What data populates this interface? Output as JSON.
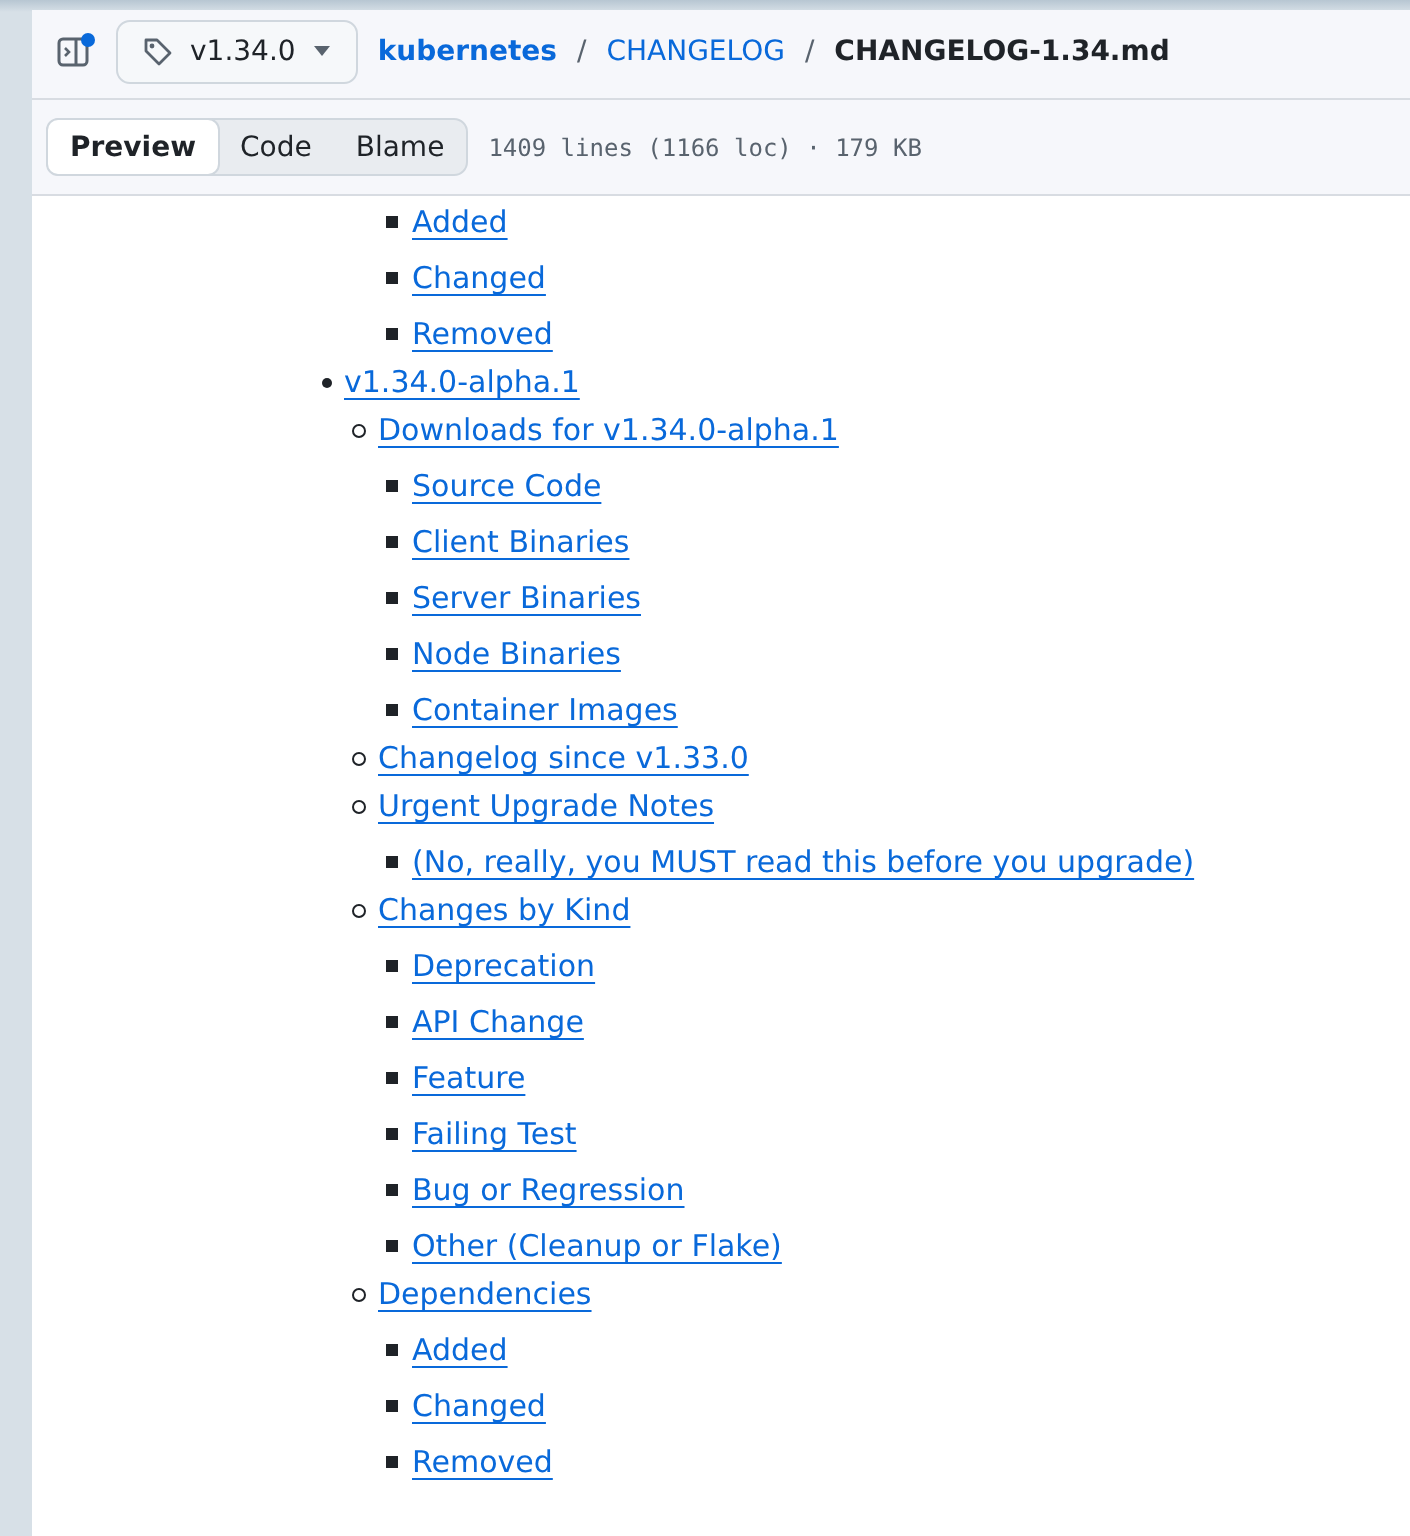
{
  "header": {
    "branch": "v1.34.0",
    "breadcrumb": [
      {
        "label": "kubernetes",
        "kind": "repo"
      },
      {
        "label": "/",
        "kind": "separator"
      },
      {
        "label": "CHANGELOG",
        "kind": "folder"
      },
      {
        "label": "/",
        "kind": "separator"
      },
      {
        "label": "CHANGELOG-1.34.md",
        "kind": "file"
      }
    ]
  },
  "toolbar": {
    "tabs": [
      {
        "label": "Preview",
        "selected": true
      },
      {
        "label": "Code",
        "selected": false
      },
      {
        "label": "Blame",
        "selected": false
      }
    ],
    "file_info": "1409 lines (1166 loc) · 179 KB"
  },
  "toc": [
    {
      "children": [
        {
          "children": [
            {
              "label": "Added"
            },
            {
              "label": "Changed"
            },
            {
              "label": "Removed"
            }
          ]
        }
      ]
    },
    {
      "label": "v1.34.0-alpha.1",
      "children": [
        {
          "label": "Downloads for v1.34.0-alpha.1",
          "children": [
            {
              "label": "Source Code"
            },
            {
              "label": "Client Binaries"
            },
            {
              "label": "Server Binaries"
            },
            {
              "label": "Node Binaries"
            },
            {
              "label": "Container Images"
            }
          ]
        },
        {
          "label": "Changelog since v1.33.0"
        },
        {
          "label": "Urgent Upgrade Notes",
          "children": [
            {
              "label": "(No, really, you MUST read this before you upgrade)"
            }
          ]
        },
        {
          "label": "Changes by Kind",
          "children": [
            {
              "label": "Deprecation"
            },
            {
              "label": "API Change"
            },
            {
              "label": "Feature"
            },
            {
              "label": "Failing Test"
            },
            {
              "label": "Bug or Regression"
            },
            {
              "label": "Other (Cleanup or Flake)"
            }
          ]
        },
        {
          "label": "Dependencies",
          "children": [
            {
              "label": "Added"
            },
            {
              "label": "Changed"
            },
            {
              "label": "Removed"
            }
          ]
        }
      ]
    }
  ]
}
